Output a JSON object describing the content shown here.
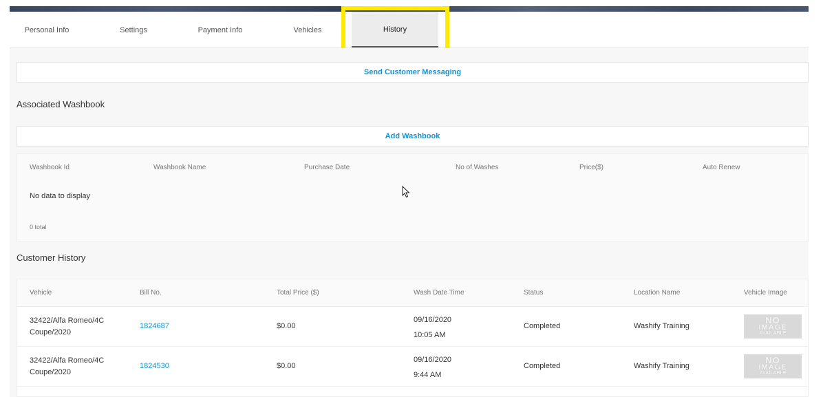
{
  "tabs": [
    {
      "label": "Personal Info"
    },
    {
      "label": "Settings"
    },
    {
      "label": "Payment Info"
    },
    {
      "label": "Vehicles"
    },
    {
      "label": "History"
    }
  ],
  "active_tab": "History",
  "send_messaging_label": "Send Customer Messaging",
  "washbook": {
    "title": "Associated Washbook",
    "add_label": "Add Washbook",
    "columns": [
      "Washbook Id",
      "Washbook Name",
      "Purchase Date",
      "No of Washes",
      "Price($)",
      "Auto Renew"
    ],
    "empty_text": "No data to display",
    "total_text": "0 total"
  },
  "customer_history": {
    "title": "Customer History",
    "columns": [
      "Vehicle",
      "Bill No.",
      "Total Price ($)",
      "Wash Date Time",
      "Status",
      "Location Name",
      "Vehicle Image"
    ],
    "rows": [
      {
        "vehicle_line1": "32422/Alfa Romeo/4C",
        "vehicle_line2": "Coupe/2020",
        "bill_no": "1824687",
        "total_price": "$0.00",
        "date": "09/16/2020",
        "time": "10:05 AM",
        "status": "Completed",
        "location": "Washify Training",
        "image_text": [
          "NO",
          "IMAGE",
          "AVAILABLE"
        ]
      },
      {
        "vehicle_line1": "32422/Alfa Romeo/4C",
        "vehicle_line2": "Coupe/2020",
        "bill_no": "1824530",
        "total_price": "$0.00",
        "date": "09/16/2020",
        "time": "9:44 AM",
        "status": "Completed",
        "location": "Washify Training",
        "image_text": [
          "NO",
          "IMAGE",
          "AVAILABLE"
        ]
      }
    ]
  },
  "colors": {
    "accent": "#1a8fc9",
    "highlight": "#ffeb00",
    "active_tab_bg": "#ececec"
  }
}
